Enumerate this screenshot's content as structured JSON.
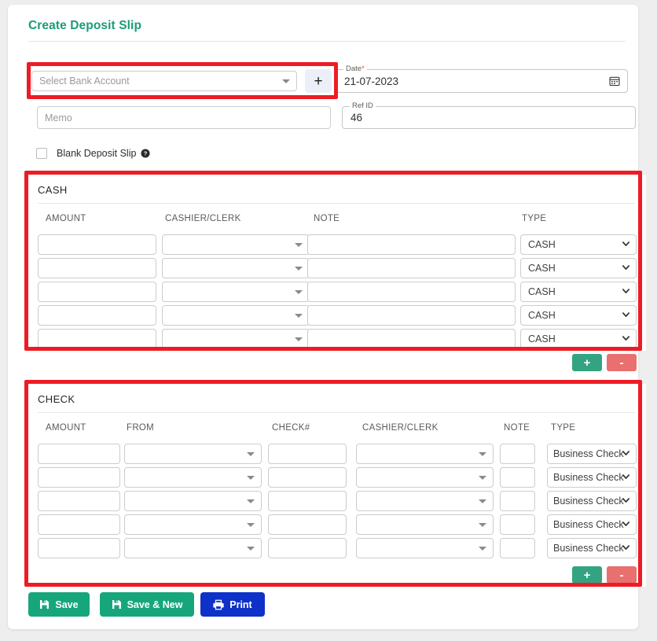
{
  "header": {
    "title": "Create Deposit Slip",
    "title_color": "#1a9c78"
  },
  "form": {
    "bank_account": {
      "placeholder": "Select Bank Account",
      "value": "",
      "add_label": "+",
      "caret_icon": "chevron-down-icon"
    },
    "date": {
      "label": "Date",
      "required_marker": "*",
      "value": "21-07-2023",
      "icon": "calendar-icon"
    },
    "memo": {
      "placeholder": "Memo",
      "value": ""
    },
    "ref_id": {
      "label": "Ref ID",
      "value": "46"
    },
    "blank_deposit_slip": {
      "label": "Blank Deposit Slip",
      "checked": false,
      "help_icon": "help-circle-icon"
    }
  },
  "cash_section": {
    "title": "CASH",
    "columns": [
      "AMOUNT",
      "CASHIER/CLERK",
      "NOTE",
      "TYPE"
    ],
    "rows": [
      {
        "amount": "",
        "cashier_clerk": "",
        "note": "",
        "type": "CASH"
      },
      {
        "amount": "",
        "cashier_clerk": "",
        "note": "",
        "type": "CASH"
      },
      {
        "amount": "",
        "cashier_clerk": "",
        "note": "",
        "type": "CASH"
      },
      {
        "amount": "",
        "cashier_clerk": "",
        "note": "",
        "type": "CASH"
      },
      {
        "amount": "",
        "cashier_clerk": "",
        "note": "",
        "type": "CASH"
      }
    ],
    "type_options": [
      "CASH"
    ],
    "add_label": "+",
    "remove_label": "-"
  },
  "check_section": {
    "title": "CHECK",
    "columns": [
      "AMOUNT",
      "FROM",
      "CHECK#",
      "CASHIER/CLERK",
      "NOTE",
      "TYPE"
    ],
    "rows": [
      {
        "amount": "",
        "from": "",
        "check_no": "",
        "cashier_clerk": "",
        "note": "",
        "type": "Business Check"
      },
      {
        "amount": "",
        "from": "",
        "check_no": "",
        "cashier_clerk": "",
        "note": "",
        "type": "Business Check"
      },
      {
        "amount": "",
        "from": "",
        "check_no": "",
        "cashier_clerk": "",
        "note": "",
        "type": "Business Check"
      },
      {
        "amount": "",
        "from": "",
        "check_no": "",
        "cashier_clerk": "",
        "note": "",
        "type": "Business Check"
      },
      {
        "amount": "",
        "from": "",
        "check_no": "",
        "cashier_clerk": "",
        "note": "",
        "type": "Business Check"
      }
    ],
    "type_options": [
      "Business Check"
    ],
    "add_label": "+",
    "remove_label": "-"
  },
  "footer": {
    "save": {
      "label": "Save",
      "icon": "save-icon",
      "color": "#17a67b"
    },
    "save_new": {
      "label": "Save & New",
      "icon": "save-icon",
      "color": "#17a67b"
    },
    "print": {
      "label": "Print",
      "icon": "printer-icon",
      "color": "#0d31c9"
    }
  },
  "highlights": {
    "color": "#ed1c24",
    "regions": [
      "bank-account-field",
      "cash-section",
      "check-section"
    ]
  }
}
